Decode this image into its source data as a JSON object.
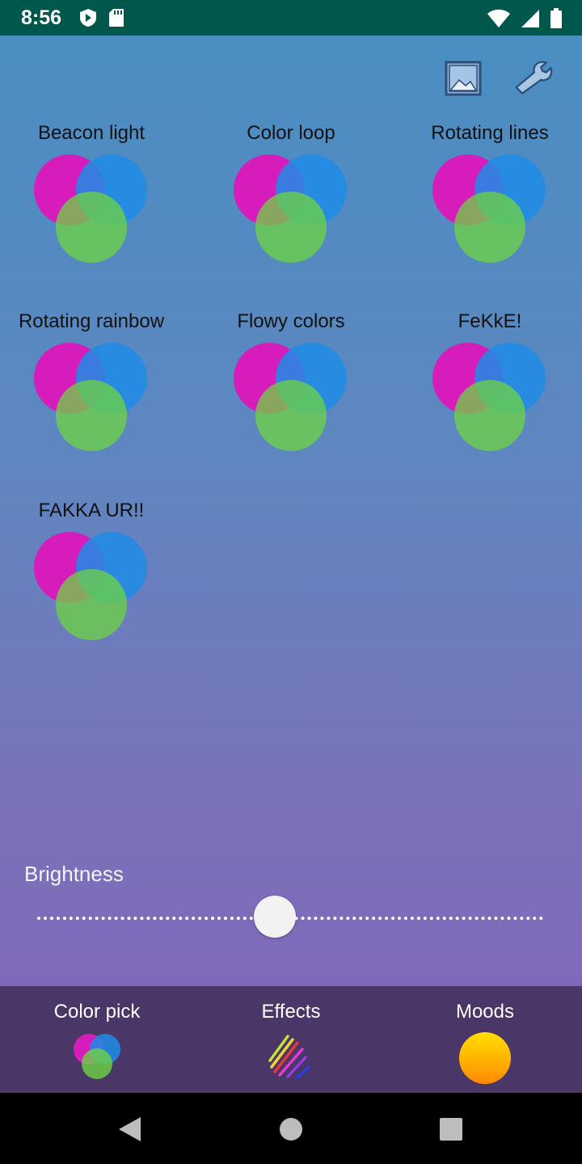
{
  "status_bar": {
    "time": "8:56",
    "left_icons": [
      "play-protect-icon",
      "sd-card-icon"
    ],
    "right_icons": [
      "wifi-icon",
      "signal-icon",
      "battery-icon"
    ],
    "background": "#00574b"
  },
  "top_actions": [
    {
      "icon": "image-icon"
    },
    {
      "icon": "wrench-icon"
    }
  ],
  "effects": [
    {
      "label": "Beacon light"
    },
    {
      "label": "Color loop"
    },
    {
      "label": "Rotating lines"
    },
    {
      "label": "Rotating rainbow"
    },
    {
      "label": "Flowy colors"
    },
    {
      "label": "FeKkE!"
    },
    {
      "label": "FAKKA UR!!"
    }
  ],
  "effect_icon_colors": {
    "magenta": "#d61dbc",
    "blue": "#1e8ce6",
    "green": "#6dd442"
  },
  "brightness": {
    "label": "Brightness",
    "value": 0.47
  },
  "bottom_nav": {
    "items": [
      {
        "label": "Color pick",
        "icon": "color-pick-icon"
      },
      {
        "label": "Effects",
        "icon": "effects-icon"
      },
      {
        "label": "Moods",
        "icon": "moods-icon"
      }
    ],
    "background": "#4a3667"
  },
  "system_nav": [
    "back-icon",
    "home-icon",
    "recents-icon"
  ]
}
